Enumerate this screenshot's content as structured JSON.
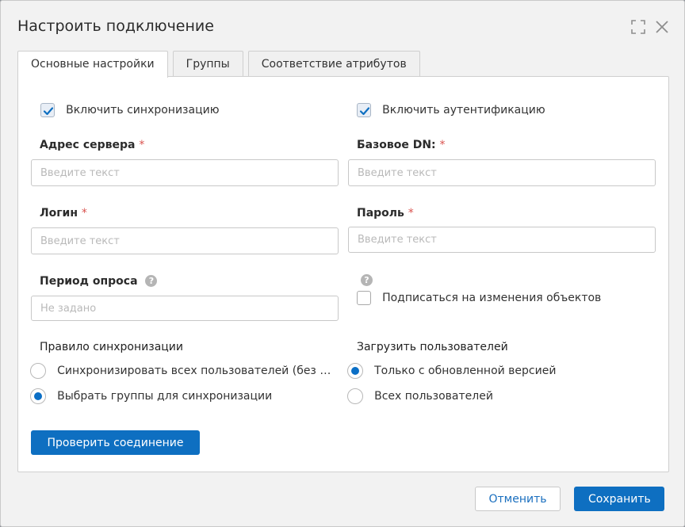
{
  "dialog": {
    "title": "Настроить подключение",
    "icons": {
      "expand": "expand-icon",
      "close": "close-icon"
    }
  },
  "tabs": [
    {
      "label": "Основные настройки",
      "active": true
    },
    {
      "label": "Группы",
      "active": false
    },
    {
      "label": "Соответствие атрибутов",
      "active": false
    }
  ],
  "form": {
    "enable_sync": {
      "label": "Включить синхронизацию",
      "checked": true
    },
    "enable_auth": {
      "label": "Включить аутентификацию",
      "checked": true
    },
    "server_address": {
      "label": "Адрес сервера",
      "required": "*",
      "placeholder": "Введите текст",
      "value": ""
    },
    "base_dn": {
      "label": "Базовое DN:",
      "required": "*",
      "placeholder": "Введите текст",
      "value": ""
    },
    "login": {
      "label": "Логин",
      "required": "*",
      "placeholder": "Введите текст",
      "value": ""
    },
    "password": {
      "label": "Пароль",
      "required": "*",
      "placeholder": "Введите текст",
      "value": ""
    },
    "poll_period": {
      "label": "Период опроса",
      "placeholder": "Не задано",
      "value": ""
    },
    "subscribe": {
      "label": "Подписаться на изменения объектов",
      "checked": false
    },
    "help_glyph": "?",
    "sync_rule": {
      "label": "Правило синхронизации",
      "options": [
        {
          "label": "Синхронизировать всех пользователей (без гру...",
          "selected": false
        },
        {
          "label": "Выбрать группы для синхронизации",
          "selected": true
        }
      ]
    },
    "load_users": {
      "label": "Загрузить пользователей",
      "options": [
        {
          "label": "Только с обновленной версией",
          "selected": true
        },
        {
          "label": "Всех пользователей",
          "selected": false
        }
      ]
    },
    "test_connection_label": "Проверить соединение"
  },
  "footer": {
    "cancel_label": "Отменить",
    "save_label": "Сохранить"
  },
  "colors": {
    "accent": "#0e6fc1",
    "required": "#d9534f"
  }
}
